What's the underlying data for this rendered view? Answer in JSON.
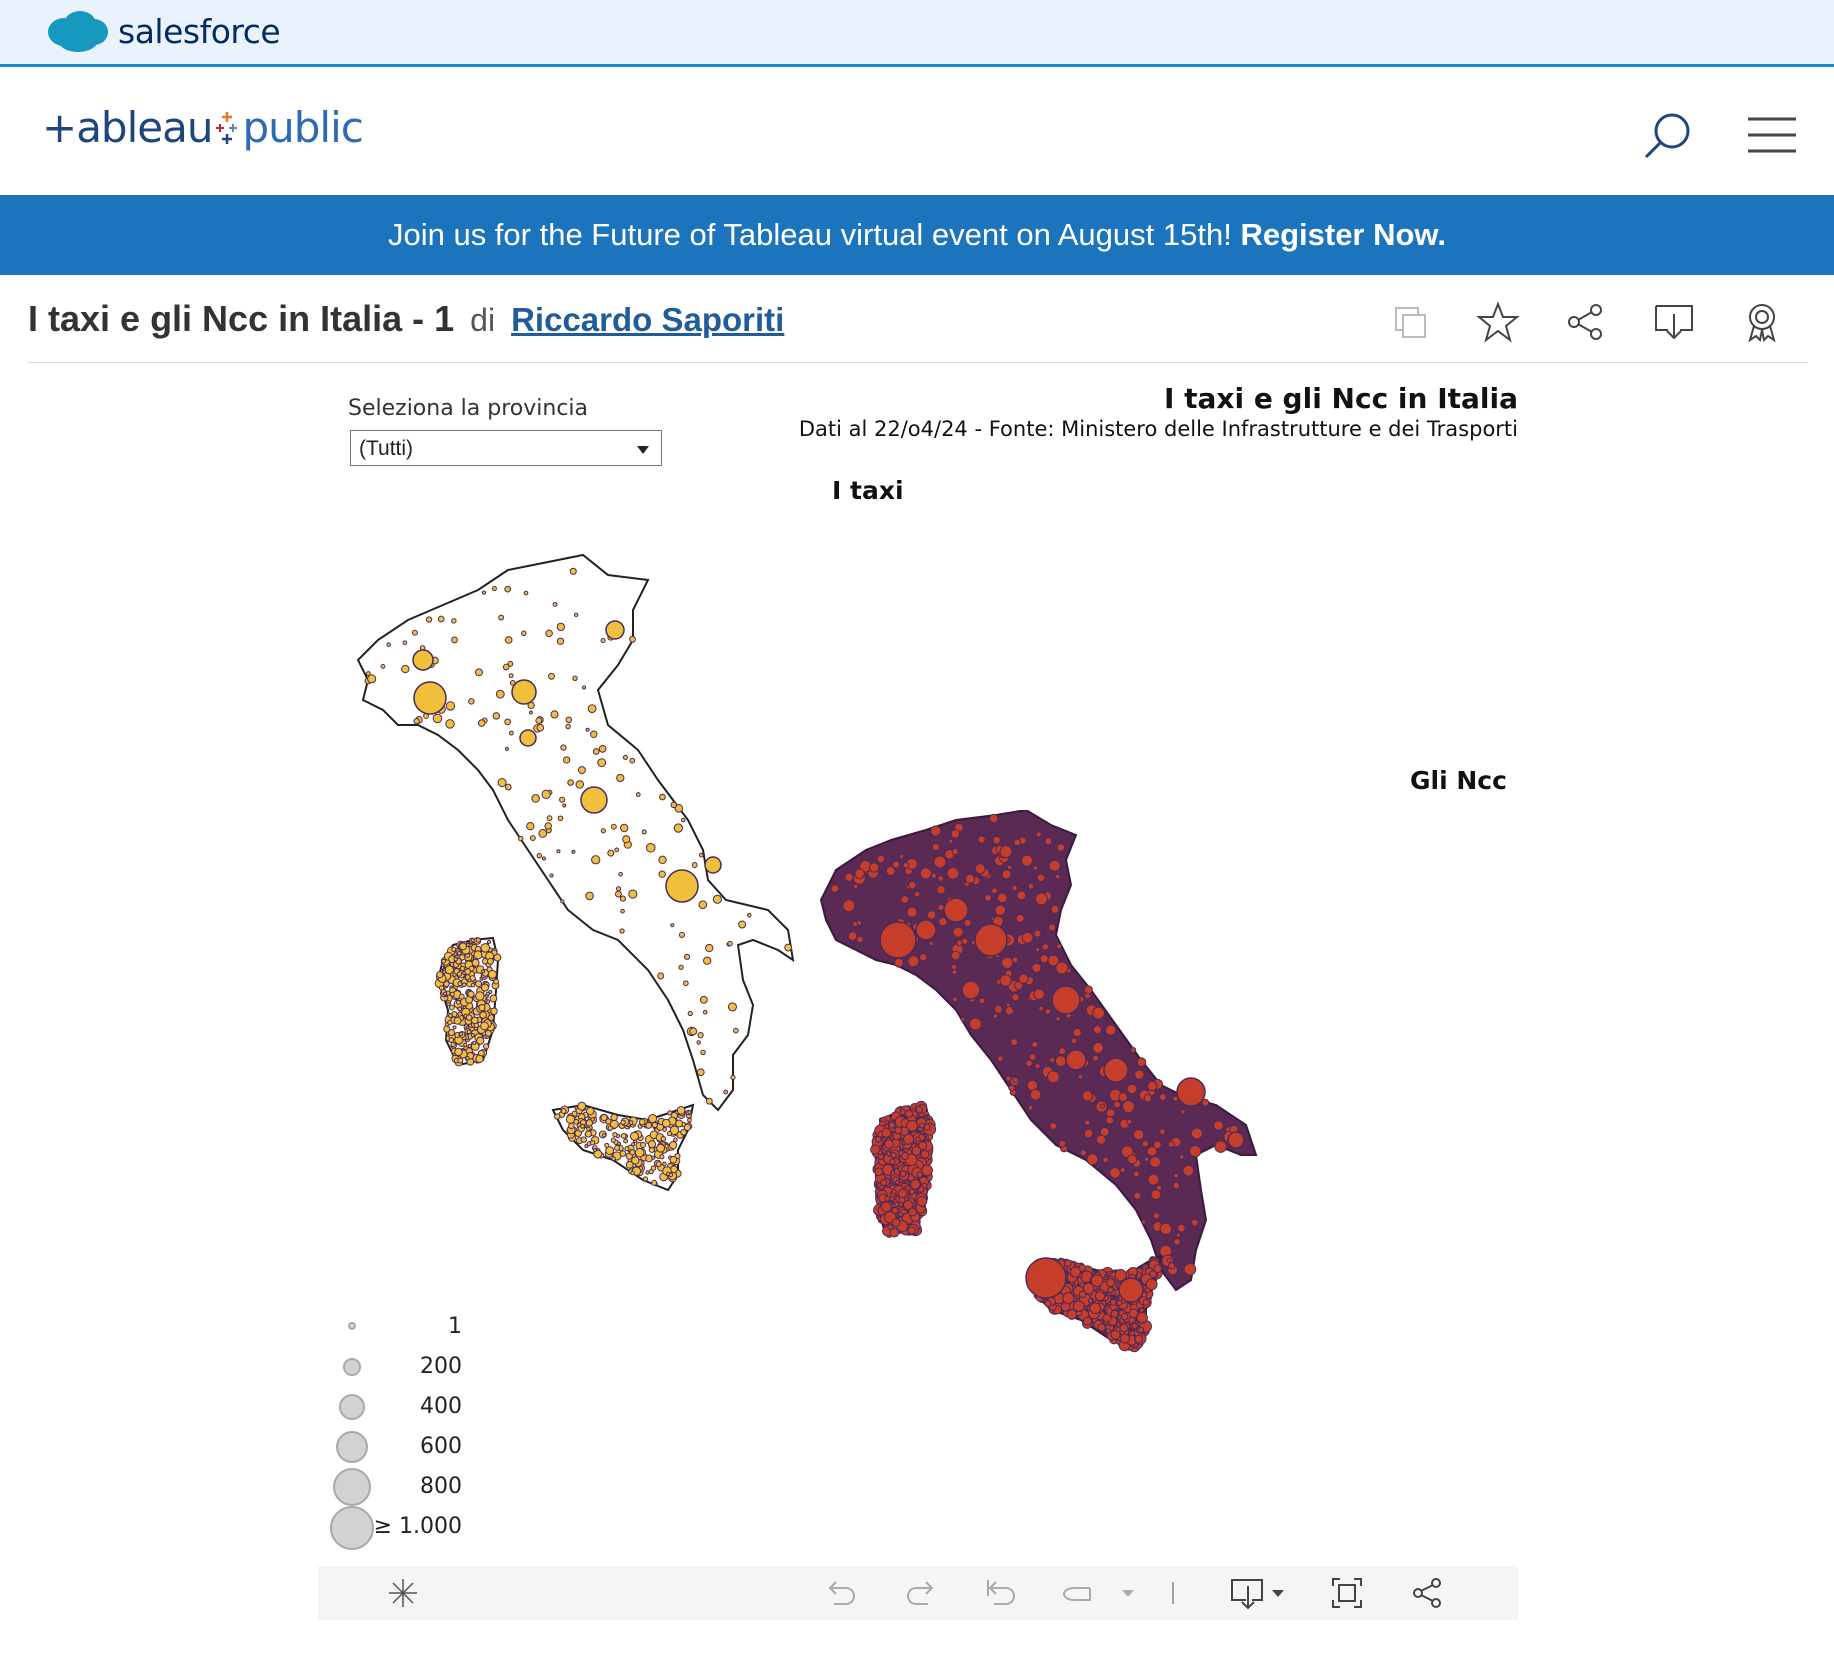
{
  "salesforce": {
    "brand": "salesforce"
  },
  "tableau": {
    "logo_main": "+ableau",
    "logo_pub": "public"
  },
  "banner": {
    "text": "Join us for the Future of Tableau virtual event on August 15th!",
    "cta": "Register Now."
  },
  "viz": {
    "title": "I taxi e gli Ncc in Italia - 1",
    "by": "di",
    "author": "Riccardo Saporiti"
  },
  "actions": [
    "copy-icon",
    "star-icon",
    "share-icon",
    "download-icon",
    "award-icon"
  ],
  "filter": {
    "label": "Seleziona la provincia",
    "value": "(Tutti)"
  },
  "dashboard": {
    "title": "I taxi e gli Ncc in Italia",
    "subtitle": "Dati al 22/o4/24 - Fonte: Ministero delle Infrastrutture e dei Trasporti",
    "map1_title": "I taxi",
    "map2_title": "Gli Ncc"
  },
  "legend": {
    "values": [
      "1",
      "200",
      "400",
      "600",
      "800",
      "≥ 1.000"
    ]
  },
  "colors": {
    "taxi": "#f0bf3c",
    "ncc": "#c63d2a",
    "border": "#4a2a5a",
    "banner": "#1c75bc"
  },
  "toolbar": [
    "tableau-icon",
    "undo-icon",
    "redo-icon",
    "revert-icon",
    "refresh-icon",
    "dropdown-icon",
    "download-icon",
    "fullscreen-icon",
    "share-icon"
  ]
}
